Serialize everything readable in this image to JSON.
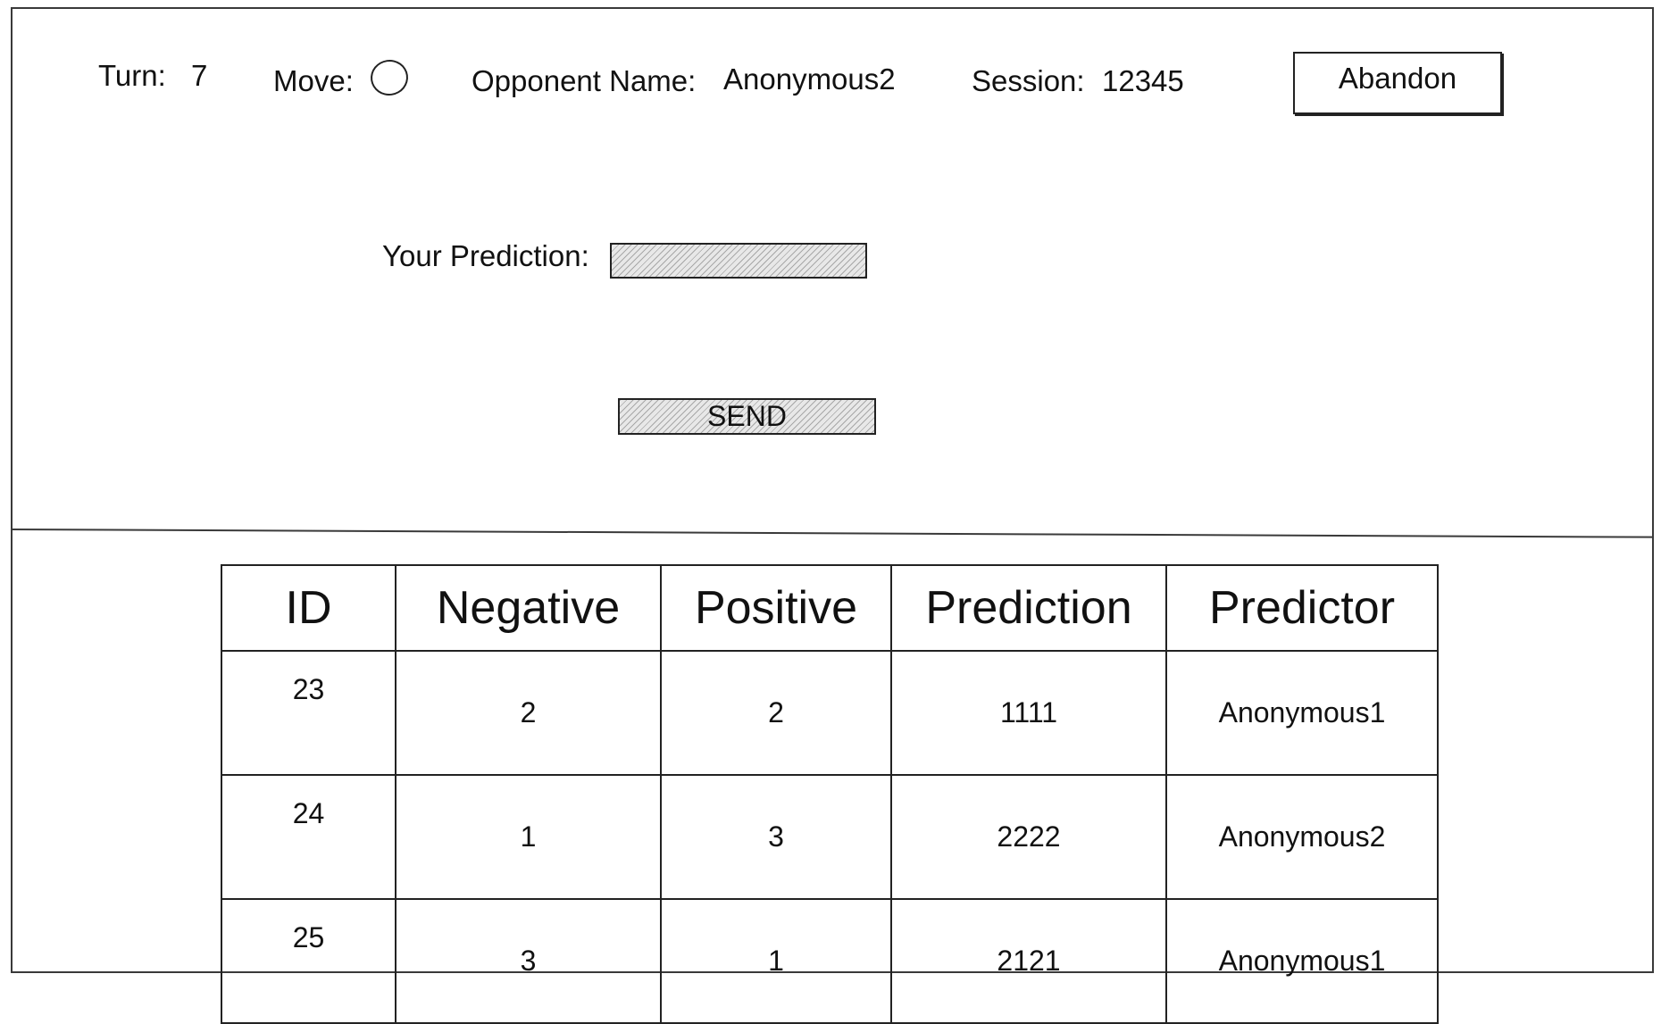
{
  "header": {
    "turn_label": "Turn:",
    "turn_value": "7",
    "move_label": "Move:",
    "opponent_label": "Opponent Name:",
    "opponent_value": "Anonymous2",
    "session_label": "Session:",
    "session_value": "12345",
    "abandon_label": "Abandon"
  },
  "form": {
    "prediction_label": "Your Prediction:",
    "prediction_value": "",
    "send_label": "SEND"
  },
  "table": {
    "headers": [
      "ID",
      "Negative",
      "Positive",
      "Prediction",
      "Predictor"
    ],
    "rows": [
      [
        "23",
        "2",
        "2",
        "1111",
        "Anonymous1"
      ],
      [
        "24",
        "1",
        "3",
        "2222",
        "Anonymous2"
      ],
      [
        "25",
        "3",
        "1",
        "2121",
        "Anonymous1"
      ]
    ]
  }
}
